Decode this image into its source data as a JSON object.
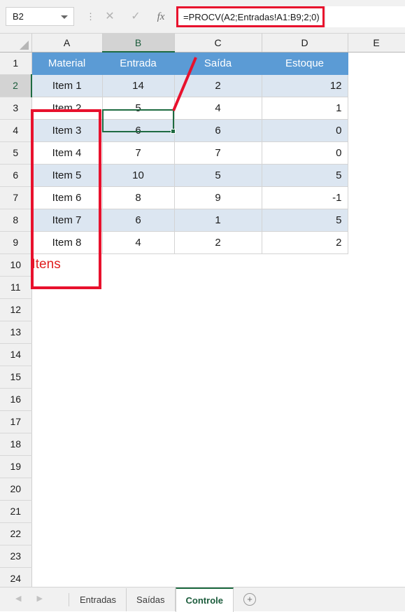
{
  "formula_bar": {
    "name_box_value": "B2",
    "formula": "=PROCV(A2;Entradas!A1:B9;2;0)",
    "cancel_icon": "close-icon",
    "confirm_icon": "check-icon",
    "function_icon": "fx"
  },
  "grid": {
    "column_headers": [
      "A",
      "B",
      "C",
      "D",
      "E"
    ],
    "selected_column": "B",
    "selected_row": "2",
    "row_numbers": [
      "1",
      "2",
      "3",
      "4",
      "5",
      "6",
      "7",
      "8",
      "9",
      "10",
      "11",
      "12",
      "13",
      "14",
      "15",
      "16",
      "17",
      "18",
      "19",
      "20",
      "21",
      "22",
      "23",
      "24"
    ],
    "table_headers": [
      "Material",
      "Entrada",
      "Saída",
      "Estoque"
    ],
    "rows": [
      {
        "material": "Item 1",
        "entrada": "14",
        "saida": "2",
        "estoque": "12"
      },
      {
        "material": "Item 2",
        "entrada": "5",
        "saida": "4",
        "estoque": "1"
      },
      {
        "material": "Item 3",
        "entrada": "6",
        "saida": "6",
        "estoque": "0"
      },
      {
        "material": "Item 4",
        "entrada": "7",
        "saida": "7",
        "estoque": "0"
      },
      {
        "material": "Item 5",
        "entrada": "10",
        "saida": "5",
        "estoque": "5"
      },
      {
        "material": "Item 6",
        "entrada": "8",
        "saida": "9",
        "estoque": "-1"
      },
      {
        "material": "Item 7",
        "entrada": "6",
        "saida": "1",
        "estoque": "5"
      },
      {
        "material": "Item 8",
        "entrada": "4",
        "saida": "2",
        "estoque": "2"
      }
    ],
    "annotation_label": "Itens"
  },
  "colors": {
    "header_blue": "#5B9BD5",
    "band_blue": "#DCE6F1",
    "annotation_red": "#E8112D",
    "note_red": "#E02020",
    "selection_green": "#1E6B41"
  },
  "tabs": {
    "sheets": [
      "Entradas",
      "Saídas",
      "Controle"
    ],
    "active_sheet": "Controle",
    "add_sheet_icon": "plus-circle-icon",
    "prev_icon": "chevron-left-icon",
    "next_icon": "chevron-right-icon"
  }
}
